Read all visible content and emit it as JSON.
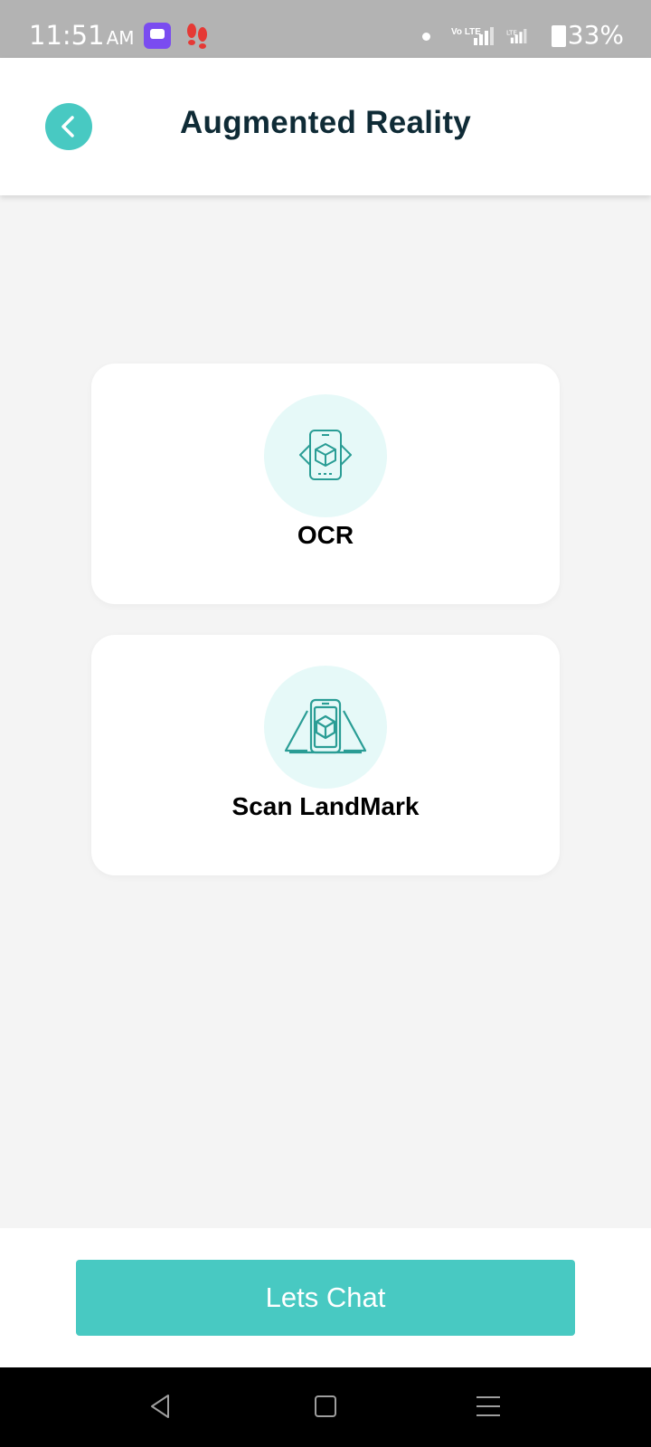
{
  "status_bar": {
    "time": "11:51",
    "ampm": "AM",
    "network_label": "Vo LTE",
    "battery": "33%"
  },
  "header": {
    "title": "Augmented Reality"
  },
  "options": [
    {
      "label": "OCR",
      "icon": "ar-phone-cube-icon"
    },
    {
      "label": "Scan LandMark",
      "icon": "landmark-scan-icon"
    }
  ],
  "footer": {
    "chat_label": "Lets Chat"
  },
  "colors": {
    "accent": "#48c9c2",
    "title": "#0f2b36",
    "icon_bg": "#e6f9f8",
    "icon_stroke": "#2a9d95"
  }
}
